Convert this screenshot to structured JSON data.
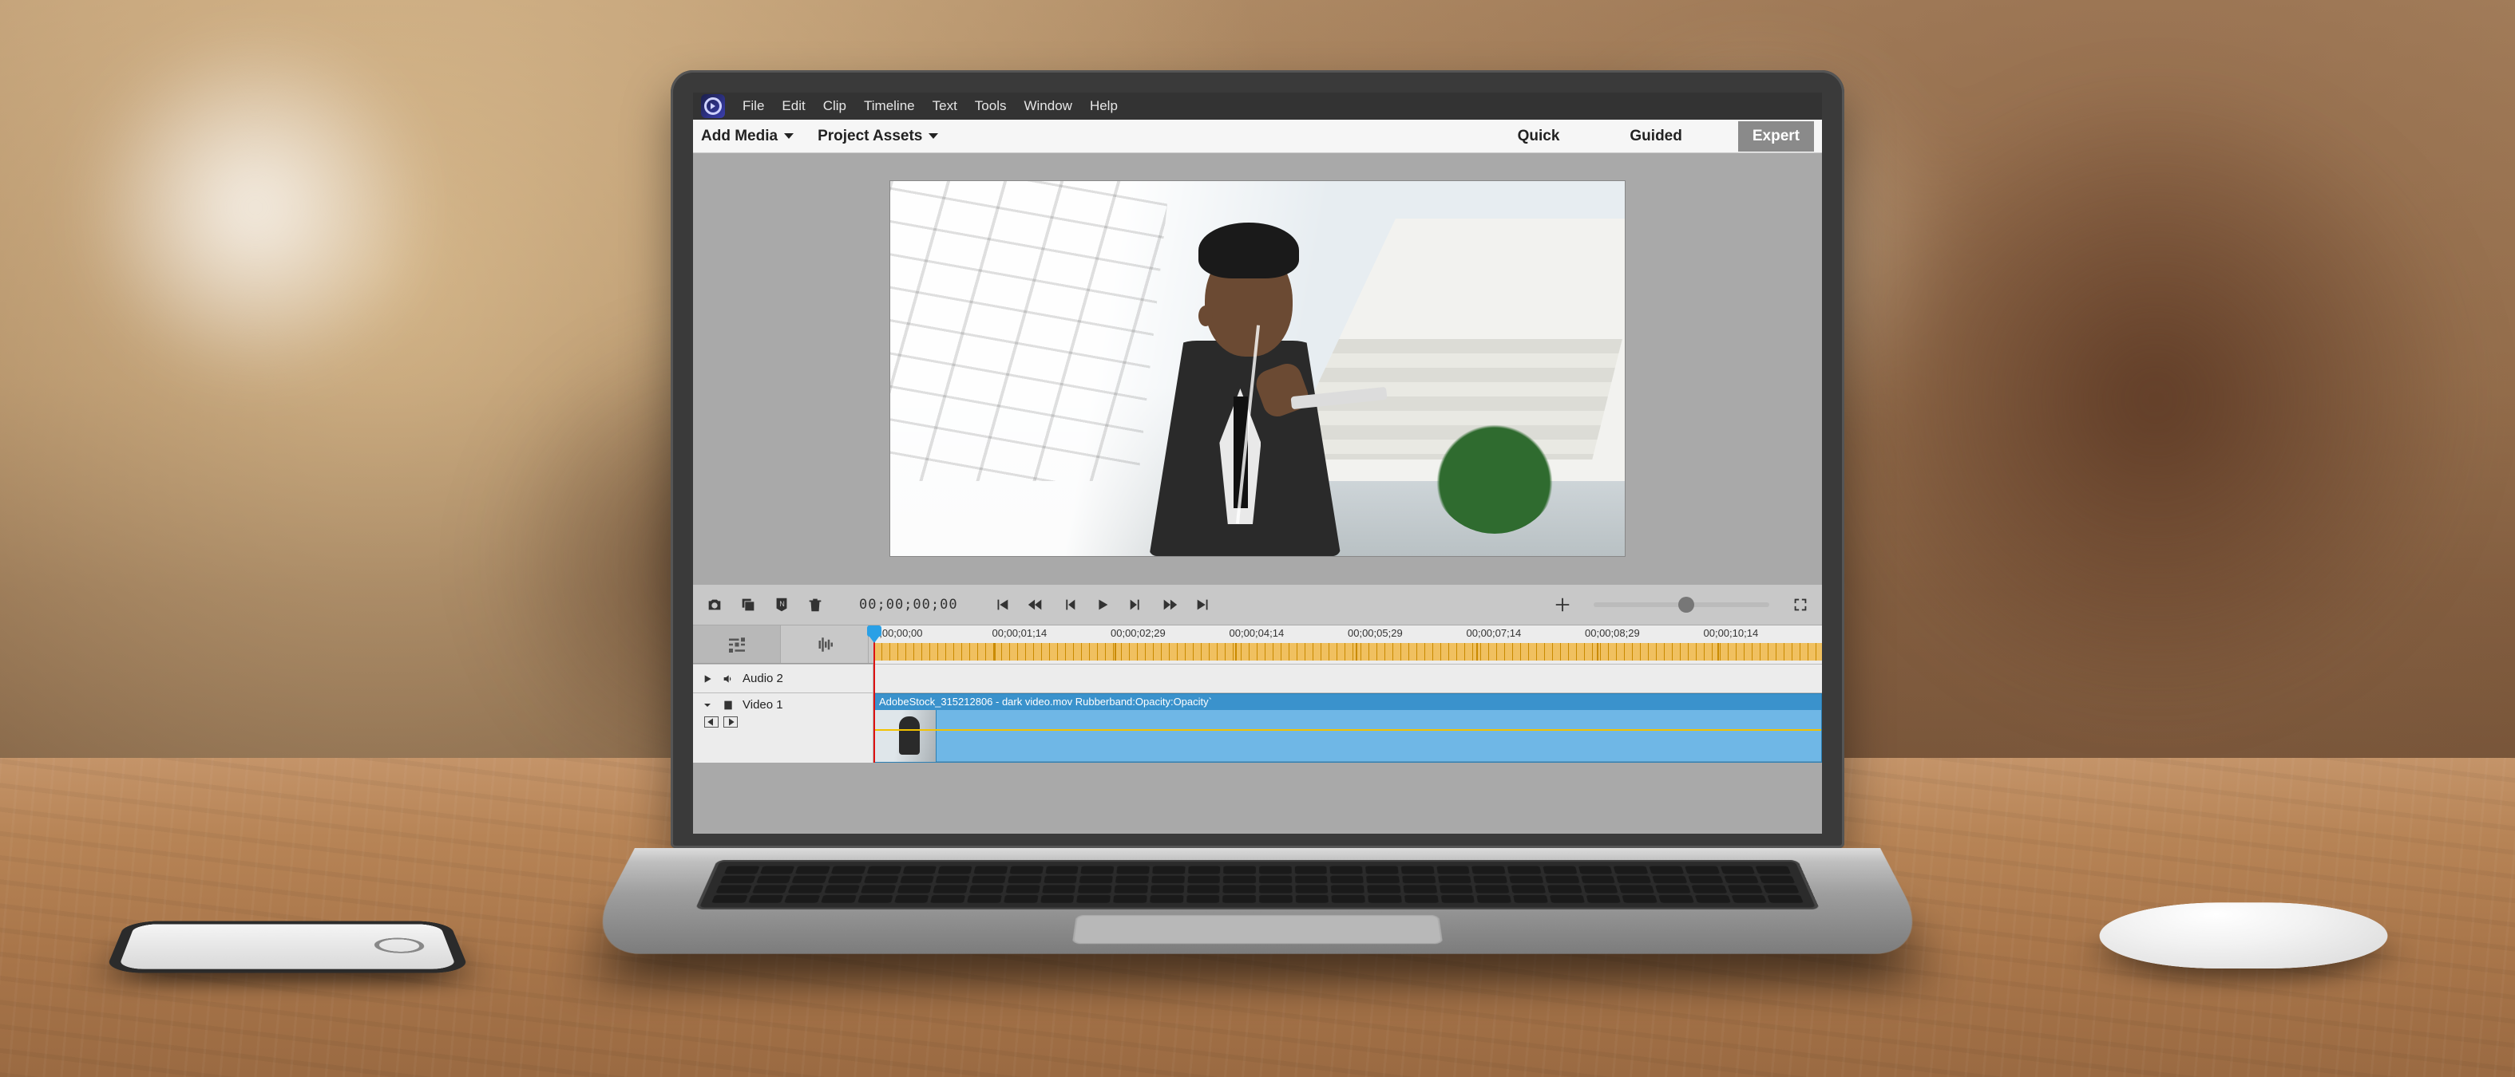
{
  "menubar": {
    "items": [
      "File",
      "Edit",
      "Clip",
      "Timeline",
      "Text",
      "Tools",
      "Window",
      "Help"
    ]
  },
  "toolbar": {
    "add_media": "Add Media",
    "project_assets": "Project Assets",
    "modes": {
      "quick": "Quick",
      "guided": "Guided",
      "expert": "Expert"
    },
    "active_mode": "expert"
  },
  "transport": {
    "timecode": "00;00;00;00"
  },
  "ruler": {
    "labels": [
      "0;00;00;00",
      "00;00;01;14",
      "00;00;02;29",
      "00;00;04;14",
      "00;00;05;29",
      "00;00;07;14",
      "00;00;08;29",
      "00;00;10;14"
    ]
  },
  "tracks": {
    "audio2": {
      "label": "Audio 2"
    },
    "video1": {
      "label": "Video 1",
      "clip_label": "AdobeStock_315212806 - dark video.mov Rubberband:Opacity:Opacity`"
    }
  },
  "icons": {
    "camera": "camera-icon",
    "dup": "duplicate-icon",
    "marker": "marker-icon",
    "trash": "trash-icon",
    "goto_start": "goto-start-icon",
    "rewind": "rewind-icon",
    "step_back": "step-back-icon",
    "play": "play-icon",
    "step_fwd": "step-forward-icon",
    "ffwd": "fast-forward-icon",
    "goto_end": "goto-end-icon",
    "fit": "fit-icon",
    "full": "fullscreen-icon",
    "tab_sliders": "sliders-icon",
    "tab_audio": "audio-waveform-icon"
  }
}
